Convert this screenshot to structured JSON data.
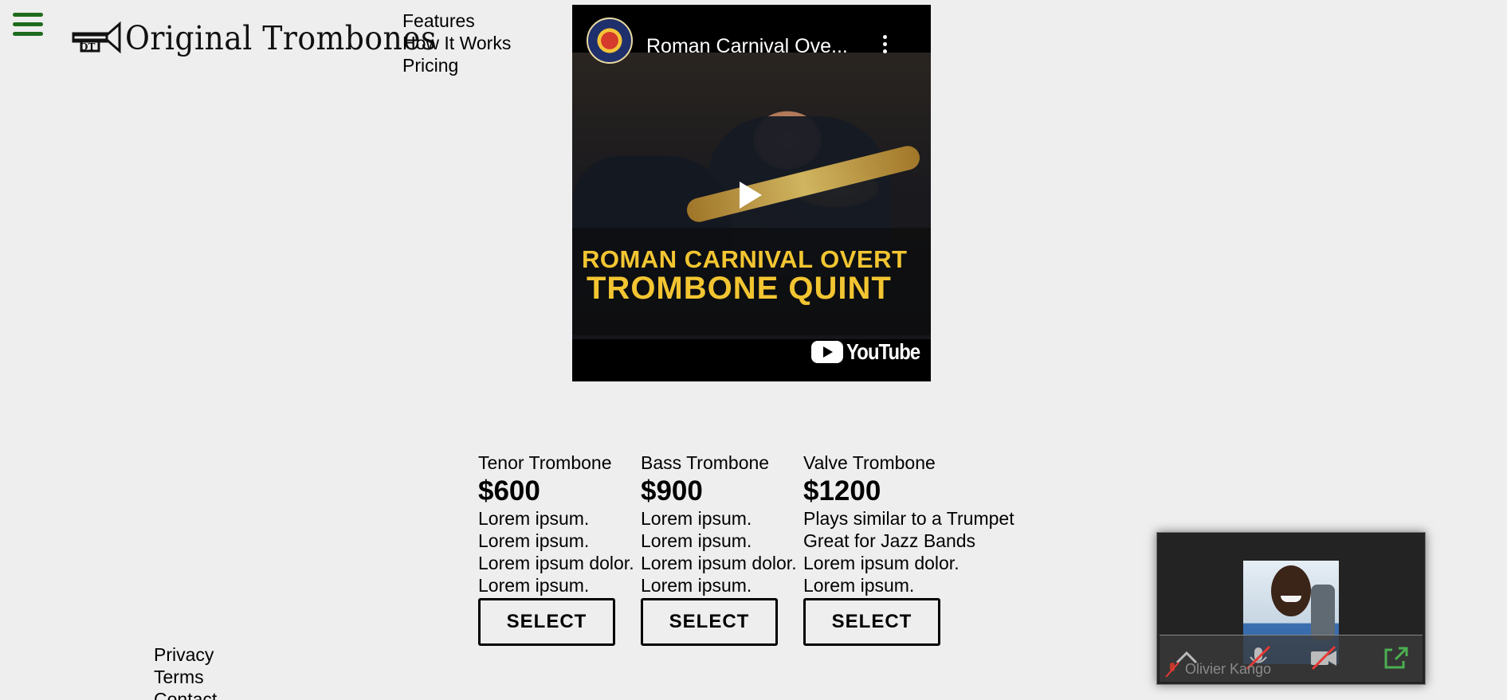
{
  "header": {
    "brand": "Original Trombones",
    "nav": [
      "Features",
      "How It Works",
      "Pricing"
    ]
  },
  "video": {
    "title": "Roman Carnival Ove...",
    "banner_line1": "ROMAN CARNIVAL OVERT",
    "banner_line2": "TROMBONE QUINT",
    "platform": "YouTube"
  },
  "pricing": {
    "button_label": "SELECT",
    "plans": [
      {
        "name": "Tenor Trombone",
        "price": "$600",
        "features": [
          "Lorem ipsum.",
          "Lorem ipsum.",
          "Lorem ipsum dolor.",
          "Lorem ipsum."
        ]
      },
      {
        "name": "Bass Trombone",
        "price": "$900",
        "features": [
          "Lorem ipsum.",
          "Lorem ipsum.",
          "Lorem ipsum dolor.",
          "Lorem ipsum."
        ]
      },
      {
        "name": "Valve Trombone",
        "price": "$1200",
        "features": [
          "Plays similar to a Trumpet",
          "Great for Jazz Bands",
          "Lorem ipsum dolor.",
          "Lorem ipsum."
        ]
      }
    ]
  },
  "footer": {
    "links": [
      "Privacy",
      "Terms",
      "Contact"
    ]
  },
  "call": {
    "participant": "Olivier Kango"
  },
  "colors": {
    "hamburger": "#1e6b1e",
    "background": "#eeeeee",
    "banner_text": "#f2c531"
  }
}
